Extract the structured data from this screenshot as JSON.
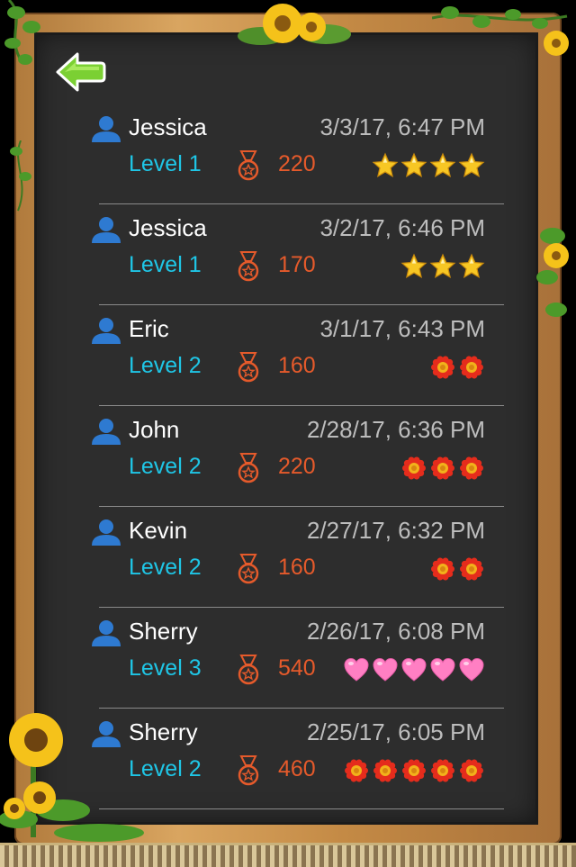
{
  "nav": {
    "back_icon": "back-arrow-icon"
  },
  "colors": {
    "name": "#ffffff",
    "date": "#bdbdbd",
    "level": "#1fc6e6",
    "score": "#e55a2b",
    "board": "#2d2d2d",
    "divider": "#8a8a8a"
  },
  "icons": {
    "user": "person-icon",
    "score": "medal-icon"
  },
  "entries": [
    {
      "name": "Jessica",
      "date": "3/3/17, 6:47 PM",
      "level": "Level 1",
      "score": "220",
      "badge_type": "star",
      "badge_count": 4
    },
    {
      "name": "Jessica",
      "date": "3/2/17, 6:46 PM",
      "level": "Level 1",
      "score": "170",
      "badge_type": "star",
      "badge_count": 3
    },
    {
      "name": "Eric",
      "date": "3/1/17, 6:43 PM",
      "level": "Level 2",
      "score": "160",
      "badge_type": "flower",
      "badge_count": 2
    },
    {
      "name": "John",
      "date": "2/28/17, 6:36 PM",
      "level": "Level 2",
      "score": "220",
      "badge_type": "flower",
      "badge_count": 3
    },
    {
      "name": "Kevin",
      "date": "2/27/17, 6:32 PM",
      "level": "Level 2",
      "score": "160",
      "badge_type": "flower",
      "badge_count": 2
    },
    {
      "name": "Sherry",
      "date": "2/26/17, 6:08 PM",
      "level": "Level 3",
      "score": "540",
      "badge_type": "heart",
      "badge_count": 5
    },
    {
      "name": "Sherry",
      "date": "2/25/17, 6:05 PM",
      "level": "Level 2",
      "score": "460",
      "badge_type": "flower",
      "badge_count": 5
    }
  ]
}
